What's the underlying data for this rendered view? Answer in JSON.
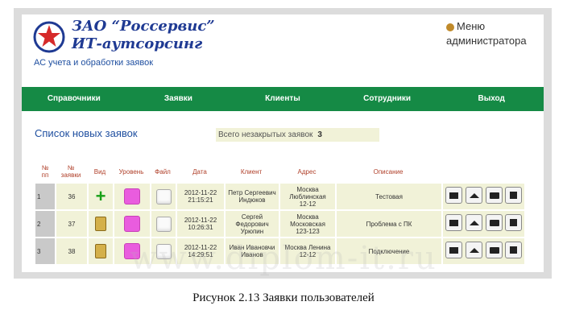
{
  "header": {
    "company_line1": "ЗАО “Россервис”",
    "company_line2": "ИТ-аутсорсинг",
    "subtitle": "АС учета и обработки заявок",
    "admin_line1": "Меню",
    "admin_line2": "администратора"
  },
  "nav": {
    "items": [
      "Справочники",
      "Заявки",
      "Клиенты",
      "Сотрудники",
      "Выход"
    ]
  },
  "list": {
    "title": "Список новых заявок",
    "total_label": "Всего незакрытых заявок",
    "total_value": "3"
  },
  "table": {
    "headers": {
      "num": "№\nпп",
      "id": "№\nзаявки",
      "kind": "Вид",
      "level": "Уровень",
      "file": "Файл",
      "date": "Дата",
      "client": "Клиент",
      "address": "Адрес",
      "description": "Описание"
    },
    "rows": [
      {
        "num": "1",
        "id": "36",
        "kind_icon": "plus-icon",
        "date": "2012-11-22\n21:15:21",
        "client": "Петр Сергеевич\nИндюков",
        "address": "Москва\nЛюблинская\n12-12",
        "description": "Тестовая"
      },
      {
        "num": "2",
        "id": "37",
        "kind_icon": "document-icon",
        "date": "2012-11-22\n10:26:31",
        "client": "Сергей\nФедорович\nУрюпин",
        "address": "Москва\nМосковская\n123-123",
        "description": "Проблема с ПК"
      },
      {
        "num": "3",
        "id": "38",
        "kind_icon": "document-icon",
        "date": "2012-11-22\n14:29:51",
        "client": "Иван Ивановчи\nИванов",
        "address": "Москва Ленина\n12-12",
        "description": "Подключение"
      }
    ],
    "action_icons": [
      "comment-icon",
      "home-icon",
      "briefcase-icon",
      "stop-icon"
    ]
  },
  "watermark": "www.diplom-it.ru",
  "caption": "Рисунок 2.13 Заявки пользователей",
  "colors": {
    "nav_bg": "#158a45",
    "row_bg": "#f1f2d8",
    "level_pink": "#e95cde",
    "header_red": "#b0402a",
    "link_blue": "#1f4fa0"
  }
}
